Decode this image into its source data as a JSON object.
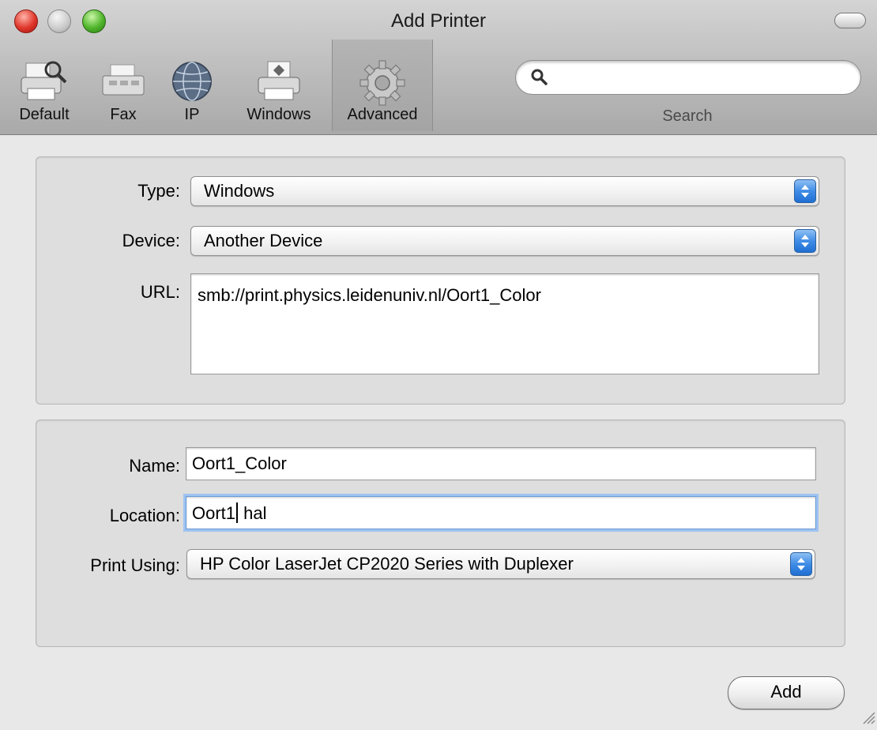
{
  "window": {
    "title": "Add Printer"
  },
  "toolbar": {
    "items": [
      {
        "label": "Default",
        "icon": "default-printer-icon"
      },
      {
        "label": "Fax",
        "icon": "fax-icon"
      },
      {
        "label": "IP",
        "icon": "globe-icon"
      },
      {
        "label": "Windows",
        "icon": "windows-printer-icon"
      },
      {
        "label": "Advanced",
        "icon": "gear-icon",
        "selected": true
      }
    ],
    "search": {
      "label": "Search",
      "value": "",
      "icon": "magnifier-icon"
    }
  },
  "connection": {
    "type_label": "Type:",
    "type_value": "Windows",
    "device_label": "Device:",
    "device_value": "Another Device",
    "url_label": "URL:",
    "url_value": "smb://print.physics.leidenuniv.nl/Oort1_Color"
  },
  "printer": {
    "name_label": "Name:",
    "name_value": "Oort1_Color",
    "location_label": "Location:",
    "location_before_caret": "Oort1",
    "location_after_caret": " hal",
    "print_using_label": "Print Using:",
    "print_using_value": "HP Color LaserJet CP2020 Series with Duplexer"
  },
  "actions": {
    "add_label": "Add"
  },
  "colors": {
    "accent": "#3f8ce6",
    "focus_ring": "#9ec3f1"
  }
}
